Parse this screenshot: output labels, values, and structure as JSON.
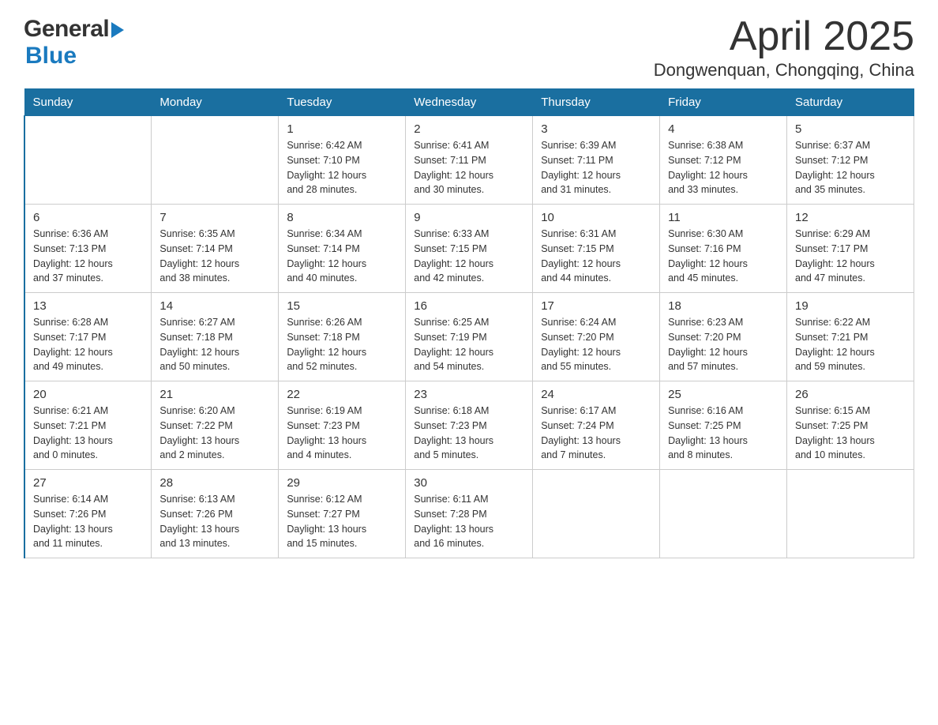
{
  "header": {
    "logo_general": "General",
    "logo_blue": "Blue",
    "title": "April 2025",
    "subtitle": "Dongwenquan, Chongqing, China"
  },
  "columns": [
    "Sunday",
    "Monday",
    "Tuesday",
    "Wednesday",
    "Thursday",
    "Friday",
    "Saturday"
  ],
  "weeks": [
    [
      {
        "day": "",
        "info": ""
      },
      {
        "day": "",
        "info": ""
      },
      {
        "day": "1",
        "info": "Sunrise: 6:42 AM\nSunset: 7:10 PM\nDaylight: 12 hours\nand 28 minutes."
      },
      {
        "day": "2",
        "info": "Sunrise: 6:41 AM\nSunset: 7:11 PM\nDaylight: 12 hours\nand 30 minutes."
      },
      {
        "day": "3",
        "info": "Sunrise: 6:39 AM\nSunset: 7:11 PM\nDaylight: 12 hours\nand 31 minutes."
      },
      {
        "day": "4",
        "info": "Sunrise: 6:38 AM\nSunset: 7:12 PM\nDaylight: 12 hours\nand 33 minutes."
      },
      {
        "day": "5",
        "info": "Sunrise: 6:37 AM\nSunset: 7:12 PM\nDaylight: 12 hours\nand 35 minutes."
      }
    ],
    [
      {
        "day": "6",
        "info": "Sunrise: 6:36 AM\nSunset: 7:13 PM\nDaylight: 12 hours\nand 37 minutes."
      },
      {
        "day": "7",
        "info": "Sunrise: 6:35 AM\nSunset: 7:14 PM\nDaylight: 12 hours\nand 38 minutes."
      },
      {
        "day": "8",
        "info": "Sunrise: 6:34 AM\nSunset: 7:14 PM\nDaylight: 12 hours\nand 40 minutes."
      },
      {
        "day": "9",
        "info": "Sunrise: 6:33 AM\nSunset: 7:15 PM\nDaylight: 12 hours\nand 42 minutes."
      },
      {
        "day": "10",
        "info": "Sunrise: 6:31 AM\nSunset: 7:15 PM\nDaylight: 12 hours\nand 44 minutes."
      },
      {
        "day": "11",
        "info": "Sunrise: 6:30 AM\nSunset: 7:16 PM\nDaylight: 12 hours\nand 45 minutes."
      },
      {
        "day": "12",
        "info": "Sunrise: 6:29 AM\nSunset: 7:17 PM\nDaylight: 12 hours\nand 47 minutes."
      }
    ],
    [
      {
        "day": "13",
        "info": "Sunrise: 6:28 AM\nSunset: 7:17 PM\nDaylight: 12 hours\nand 49 minutes."
      },
      {
        "day": "14",
        "info": "Sunrise: 6:27 AM\nSunset: 7:18 PM\nDaylight: 12 hours\nand 50 minutes."
      },
      {
        "day": "15",
        "info": "Sunrise: 6:26 AM\nSunset: 7:18 PM\nDaylight: 12 hours\nand 52 minutes."
      },
      {
        "day": "16",
        "info": "Sunrise: 6:25 AM\nSunset: 7:19 PM\nDaylight: 12 hours\nand 54 minutes."
      },
      {
        "day": "17",
        "info": "Sunrise: 6:24 AM\nSunset: 7:20 PM\nDaylight: 12 hours\nand 55 minutes."
      },
      {
        "day": "18",
        "info": "Sunrise: 6:23 AM\nSunset: 7:20 PM\nDaylight: 12 hours\nand 57 minutes."
      },
      {
        "day": "19",
        "info": "Sunrise: 6:22 AM\nSunset: 7:21 PM\nDaylight: 12 hours\nand 59 minutes."
      }
    ],
    [
      {
        "day": "20",
        "info": "Sunrise: 6:21 AM\nSunset: 7:21 PM\nDaylight: 13 hours\nand 0 minutes."
      },
      {
        "day": "21",
        "info": "Sunrise: 6:20 AM\nSunset: 7:22 PM\nDaylight: 13 hours\nand 2 minutes."
      },
      {
        "day": "22",
        "info": "Sunrise: 6:19 AM\nSunset: 7:23 PM\nDaylight: 13 hours\nand 4 minutes."
      },
      {
        "day": "23",
        "info": "Sunrise: 6:18 AM\nSunset: 7:23 PM\nDaylight: 13 hours\nand 5 minutes."
      },
      {
        "day": "24",
        "info": "Sunrise: 6:17 AM\nSunset: 7:24 PM\nDaylight: 13 hours\nand 7 minutes."
      },
      {
        "day": "25",
        "info": "Sunrise: 6:16 AM\nSunset: 7:25 PM\nDaylight: 13 hours\nand 8 minutes."
      },
      {
        "day": "26",
        "info": "Sunrise: 6:15 AM\nSunset: 7:25 PM\nDaylight: 13 hours\nand 10 minutes."
      }
    ],
    [
      {
        "day": "27",
        "info": "Sunrise: 6:14 AM\nSunset: 7:26 PM\nDaylight: 13 hours\nand 11 minutes."
      },
      {
        "day": "28",
        "info": "Sunrise: 6:13 AM\nSunset: 7:26 PM\nDaylight: 13 hours\nand 13 minutes."
      },
      {
        "day": "29",
        "info": "Sunrise: 6:12 AM\nSunset: 7:27 PM\nDaylight: 13 hours\nand 15 minutes."
      },
      {
        "day": "30",
        "info": "Sunrise: 6:11 AM\nSunset: 7:28 PM\nDaylight: 13 hours\nand 16 minutes."
      },
      {
        "day": "",
        "info": ""
      },
      {
        "day": "",
        "info": ""
      },
      {
        "day": "",
        "info": ""
      }
    ]
  ]
}
